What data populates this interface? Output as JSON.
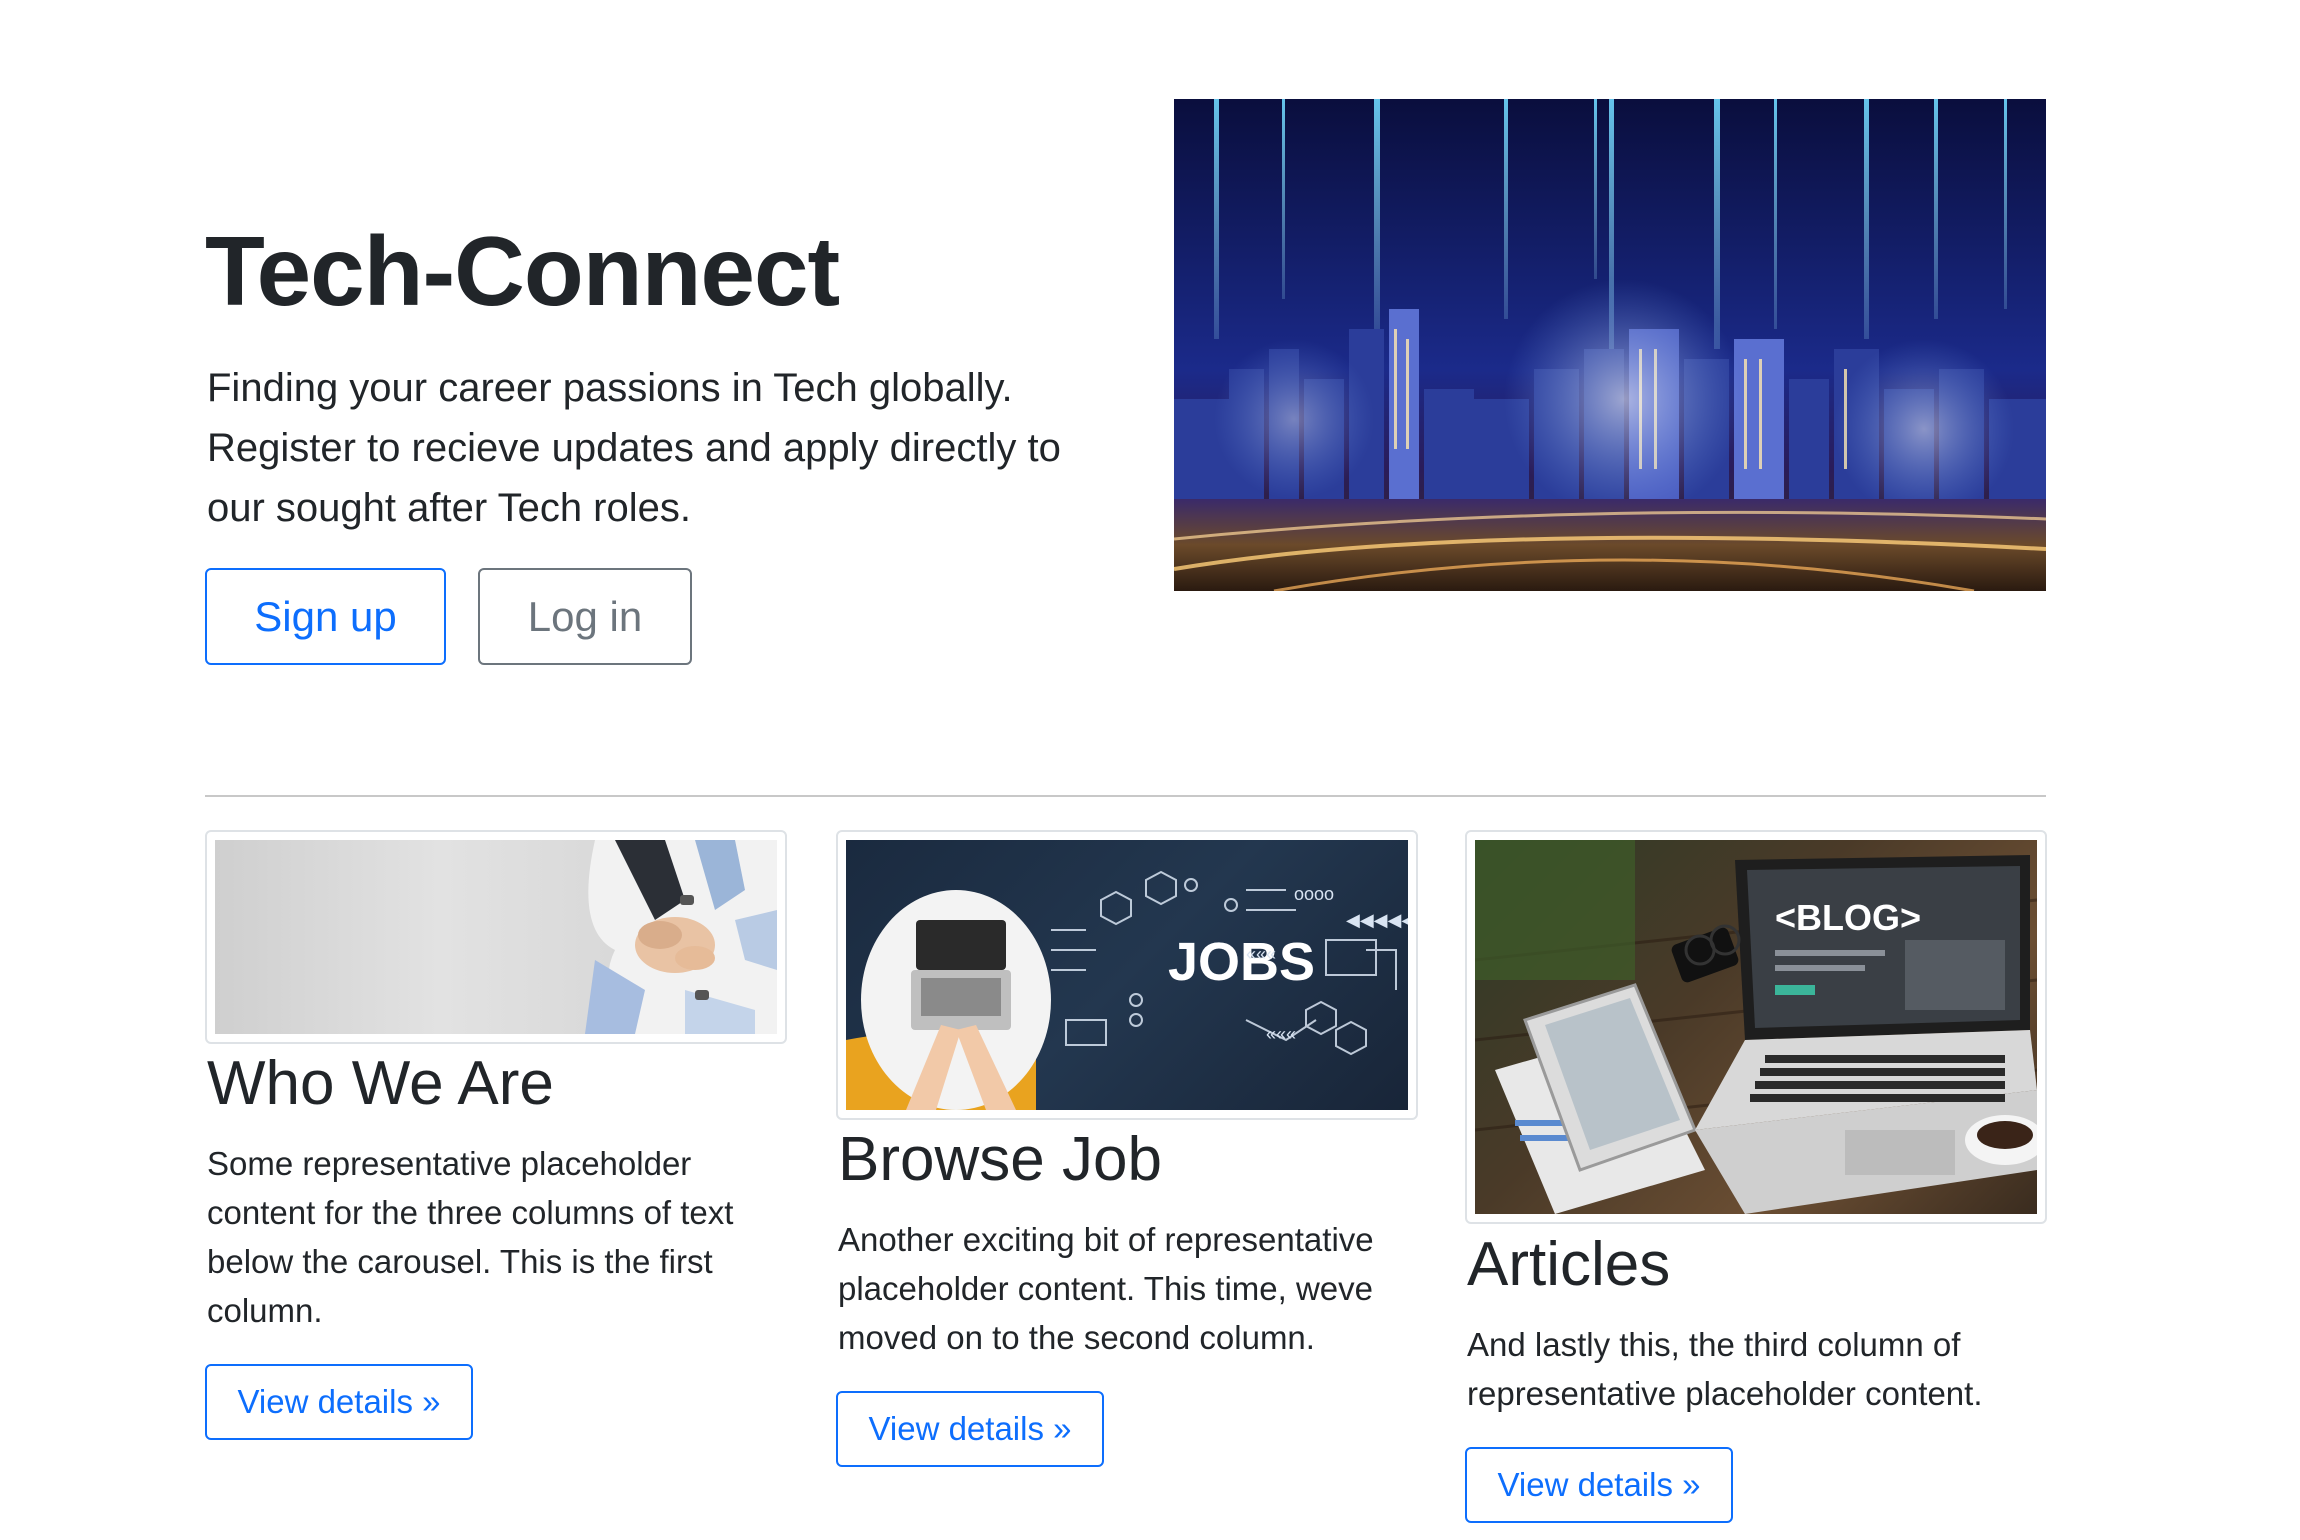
{
  "hero": {
    "title": "Tech-Connect",
    "lead": "Finding your career passions in Tech globally. Register to recieve updates and apply directly to our sought after Tech roles.",
    "signup_label": "Sign up",
    "login_label": "Log in"
  },
  "columns": [
    {
      "title": "Who We Are",
      "text": "Some representative placeholder content for the three columns of text below the carousel. This is the first column.",
      "button_label": "View details »"
    },
    {
      "title": "Browse Job",
      "text": "Another exciting bit of representative placeholder content. This time, weve moved on to the second column.",
      "button_label": "View details »",
      "image_text": "JOBS"
    },
    {
      "title": "Articles",
      "text": "And lastly this, the third column of representative placeholder content.",
      "button_label": "View details »",
      "image_text": "<BLOG>"
    }
  ],
  "colors": {
    "primary": "#0d6efd",
    "secondary": "#6c757d",
    "text": "#212529"
  }
}
